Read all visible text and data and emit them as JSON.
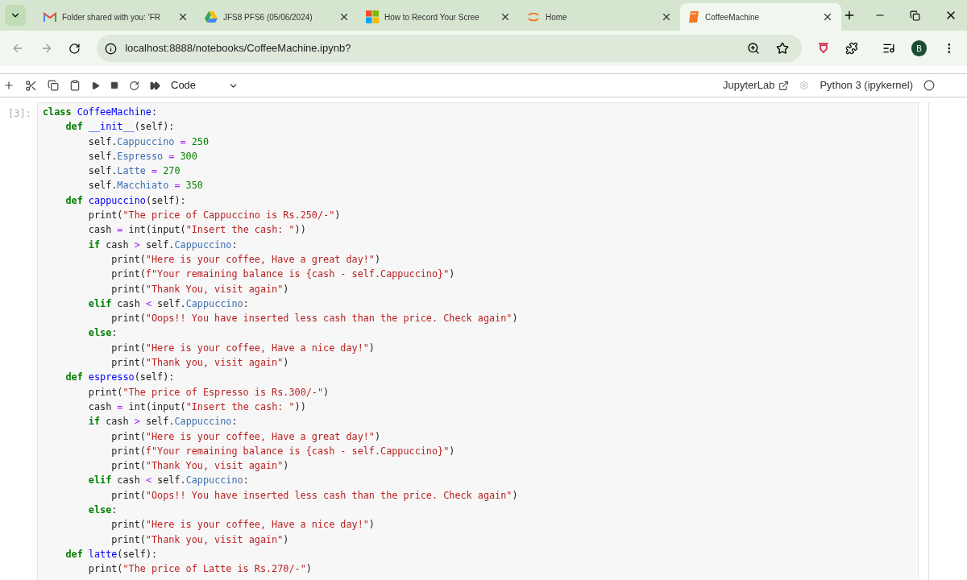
{
  "browser": {
    "tabs": [
      {
        "title": "Folder shared with you: 'FR",
        "kind": "mail",
        "selected": false
      },
      {
        "title": "JFS8   PFS6 (05/06/2024)",
        "kind": "drive",
        "selected": false
      },
      {
        "title": "How to Record Your Scree",
        "kind": "windows",
        "selected": false
      },
      {
        "title": "Home",
        "kind": "jupyter",
        "selected": false
      },
      {
        "title": "CoffeeMachine",
        "kind": "notebook",
        "selected": true
      }
    ],
    "url": "localhost:8888/notebooks/CoffeeMachine.ipynb?",
    "profile": "B"
  },
  "toolbar": {
    "cell_type": "Code",
    "jupyterlab": "JupyterLab",
    "kernel": "Python 3 (ipykernel)"
  },
  "cell": {
    "prompt": "[3]:",
    "lines": [
      "class CoffeeMachine:",
      "    def __init__(self):",
      "        self.Cappuccino = 250",
      "        self.Espresso = 300",
      "        self.Latte = 270",
      "        self.Macchiato = 350",
      "    def cappuccino(self):",
      "        print(\"The price of Cappuccino is Rs.250/-\")",
      "        cash = int(input(\"Insert the cash: \"))",
      "        if cash > self.Cappuccino:",
      "            print(\"Here is your coffee, Have a great day!\")",
      "            print(f\"Your remaining balance is {cash - self.Cappuccino}\")",
      "            print(\"Thank You, visit again\")",
      "        elif cash < self.Cappuccino:",
      "            print(\"Oops!! You have inserted less cash than the price. Check again\")",
      "        else:",
      "            print(\"Here is your coffee, Have a nice day!\")",
      "            print(\"Thank you, visit again\")",
      "    def espresso(self):",
      "        print(\"The price of Espresso is Rs.300/-\")",
      "        cash = int(input(\"Insert the cash: \"))",
      "        if cash > self.Cappuccino:",
      "            print(\"Here is your coffee, Have a great day!\")",
      "            print(f\"Your remaining balance is {cash - self.Cappuccino}\")",
      "            print(\"Thank You, visit again\")",
      "        elif cash < self.Cappuccino:",
      "            print(\"Oops!! You have inserted less cash than the price. Check again\")",
      "        else:",
      "            print(\"Here is your coffee, Have a nice day!\")",
      "            print(\"Thank you, visit again\")",
      "    def latte(self):",
      "        print(\"The price of Latte is Rs.270/-\")"
    ]
  }
}
